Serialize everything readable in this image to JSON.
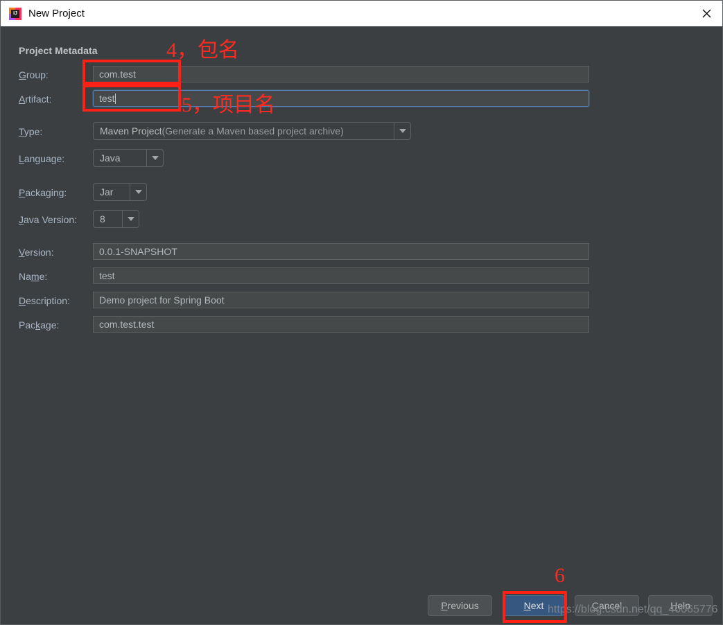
{
  "window": {
    "title": "New Project",
    "app_icon": "intellij-idea-icon",
    "icon_letters": "IJ",
    "close_icon": "close-icon"
  },
  "form": {
    "section_title": "Project Metadata",
    "fields": [
      {
        "label": "Group:",
        "mnemonic": "G",
        "value": "com.test"
      },
      {
        "label": "Artifact:",
        "mnemonic": "A",
        "value": "test"
      },
      {
        "label": "Type:",
        "mnemonic": "T",
        "value": "Maven Project",
        "value_dim": " (Generate a Maven based project archive)"
      },
      {
        "label": "Language:",
        "mnemonic": "L",
        "value": "Java"
      },
      {
        "label": "Packaging:",
        "mnemonic": "P",
        "value": "Jar"
      },
      {
        "label": "Java Version:",
        "mnemonic": "J",
        "value": "8"
      },
      {
        "label": "Version:",
        "mnemonic": "V",
        "value": "0.0.1-SNAPSHOT"
      },
      {
        "label": "Name:",
        "mnemonic": "m",
        "value": "test"
      },
      {
        "label": "Description:",
        "mnemonic": "D",
        "value": "Demo project for Spring Boot"
      },
      {
        "label": "Package:",
        "mnemonic": "k",
        "value": "com.test.test"
      }
    ]
  },
  "labels": {
    "group": "Group:",
    "artifact": "Artifact:",
    "type": "Type:",
    "language": "Language:",
    "packaging": "Packaging:",
    "java_version": "Java Version:",
    "version": "Version:",
    "name": "Name:",
    "description": "Description:",
    "package": "Package:"
  },
  "label_parts": {
    "group": {
      "pre": "",
      "mn": "G",
      "post": "roup:"
    },
    "artifact": {
      "pre": "",
      "mn": "A",
      "post": "rtifact:"
    },
    "type": {
      "pre": "",
      "mn": "T",
      "post": "ype:"
    },
    "language": {
      "pre": "",
      "mn": "L",
      "post": "anguage:"
    },
    "packaging": {
      "pre": "",
      "mn": "P",
      "post": "ackaging:"
    },
    "java_version": {
      "pre": "",
      "mn": "J",
      "post": "ava Version:"
    },
    "version": {
      "pre": "",
      "mn": "V",
      "post": "ersion:"
    },
    "name": {
      "pre": "Na",
      "mn": "m",
      "post": "e:"
    },
    "description": {
      "pre": "",
      "mn": "D",
      "post": "escription:"
    },
    "package": {
      "pre": "Pac",
      "mn": "k",
      "post": "age:"
    }
  },
  "values": {
    "group": "com.test",
    "artifact": "test",
    "type_main": "Maven Project",
    "type_dim": " (Generate a Maven based project archive)",
    "language": "Java",
    "packaging": "Jar",
    "java_version": "8",
    "version": "0.0.1-SNAPSHOT",
    "name": "test",
    "description": "Demo project for Spring Boot",
    "package": "com.test.test"
  },
  "annotations": [
    {
      "id": "a4",
      "text": "4，包名"
    },
    {
      "id": "a5",
      "text": "5，项目名"
    },
    {
      "id": "a6",
      "text": "6"
    }
  ],
  "annotation_text": {
    "step4": "4，包名",
    "step5": "5，项目名",
    "step6": "6"
  },
  "buttons": {
    "previous": {
      "pre": "",
      "mn": "P",
      "post": "revious"
    },
    "next": {
      "pre": "",
      "mn": "N",
      "post": "ext"
    },
    "cancel": {
      "pre": "",
      "mn": "C",
      "post": "ancel"
    },
    "help": {
      "pre": "",
      "mn": "H",
      "post": "elp"
    }
  },
  "watermark": "https://blog.csdn.net/qq_40065776",
  "colors": {
    "window_bg": "#3c3f41",
    "titlebar_bg": "#ffffff",
    "field_bg": "#45494a",
    "label_fg": "#a9b7c6",
    "accent_focus": "#5480b6",
    "primary_button": "#365880",
    "annotation_red": "#ff2116",
    "watermark_fg": "#7e8387"
  }
}
